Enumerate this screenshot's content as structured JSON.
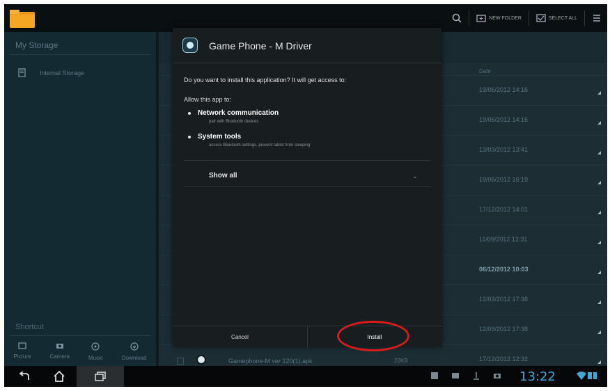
{
  "topbar": {
    "new_folder_label": "NEW FOLDER",
    "select_all_label": "SELECT ALL"
  },
  "sidebar": {
    "header": "My Storage",
    "items": [
      {
        "label": "Internal Storage",
        "icon": "storage-icon"
      }
    ],
    "shortcut_header": "Shortcut",
    "shortcuts": [
      {
        "label": "Picture",
        "icon": "picture-icon"
      },
      {
        "label": "Camera",
        "icon": "camera-icon"
      },
      {
        "label": "Music",
        "icon": "music-icon"
      },
      {
        "label": "Download",
        "icon": "download-icon"
      }
    ]
  },
  "main": {
    "date_header": "Date",
    "rows": [
      {
        "date": "19/06/2012 14:16",
        "bold": false
      },
      {
        "date": "19/06/2012 14:16",
        "bold": false
      },
      {
        "date": "13/03/2012 13:41",
        "bold": false
      },
      {
        "date": "19/06/2012 16:19",
        "bold": false
      },
      {
        "date": "17/12/2012 14:01",
        "bold": false
      },
      {
        "date": "11/09/2012 12:31",
        "bold": false
      },
      {
        "date": "06/12/2012 10:03",
        "bold": true
      },
      {
        "date": "12/03/2012 17:38",
        "bold": false
      },
      {
        "date": "12/03/2012 17:38",
        "bold": false
      }
    ],
    "last_row": {
      "name": "Gamephone-M ver 120(1).apk",
      "size": "22KB",
      "date": "17/12/2012 12:32"
    }
  },
  "dialog": {
    "title": "Game Phone - M Driver",
    "question": "Do you want to install this application? It will get access to:",
    "allow_label": "Allow this app to:",
    "permissions": [
      {
        "title": "Network communication",
        "desc": "pair with Bluetooth devices"
      },
      {
        "title": "System tools",
        "desc": "access Bluetooth settings, prevent tablet from sleeping"
      }
    ],
    "show_all": "Show all",
    "cancel_label": "Cancel",
    "install_label": "Install"
  },
  "statusbar": {
    "time": "13:22"
  },
  "colors": {
    "clock": "#3fa9d6",
    "highlight": "#d81c1c",
    "accent_folder": "#f5a623"
  }
}
